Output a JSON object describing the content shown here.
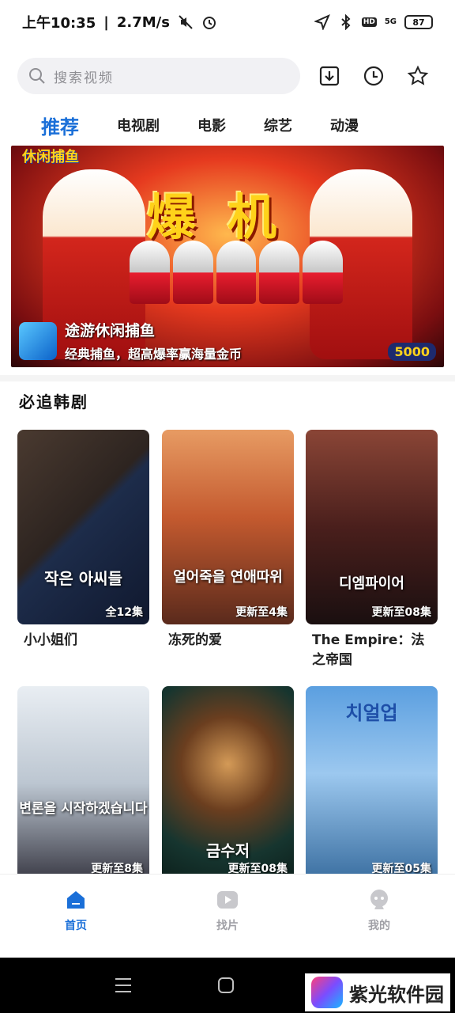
{
  "status": {
    "time": "上午10:35",
    "speed": "2.7M/s",
    "network": "5G",
    "hd": "HD",
    "battery": "87"
  },
  "search": {
    "placeholder": "搜索视频"
  },
  "top_icons": [
    "download-icon",
    "history-icon",
    "star-icon"
  ],
  "tabs": [
    "推荐",
    "电视剧",
    "电影",
    "综艺",
    "动漫"
  ],
  "banner": {
    "art_text": "爆机",
    "badge_text": "休闲捕鱼",
    "promo_title": "途游休闲捕鱼",
    "promo_subtitle": "经典捕鱼，超高爆率赢海量金币",
    "coin_value": "5000"
  },
  "section": {
    "title": "必追韩剧",
    "items": [
      {
        "title": "小小姐们",
        "episodes": "全12集",
        "poster_text": "작은 아씨들"
      },
      {
        "title": "冻死的爱",
        "episodes": "更新至4集",
        "poster_text": "얼어죽을 연애따위"
      },
      {
        "title": "The Empire：法之帝国",
        "episodes": "更新至08集",
        "poster_text": "디엠파이어"
      },
      {
        "title": "",
        "episodes": "更新至8集",
        "poster_text": "변론을 시작하겠습니다"
      },
      {
        "title": "",
        "episodes": "更新至08集",
        "poster_text": "금수저"
      },
      {
        "title": "",
        "episodes": "更新至05集",
        "poster_text": "치얼업"
      }
    ]
  },
  "bottom_nav": [
    {
      "label": "首页",
      "active": true
    },
    {
      "label": "找片",
      "active": false
    },
    {
      "label": "我的",
      "active": false
    }
  ],
  "watermark": {
    "text": "紫光软件园"
  },
  "colors": {
    "accent": "#1a6fd8",
    "inactive": "#a0a0a6"
  }
}
